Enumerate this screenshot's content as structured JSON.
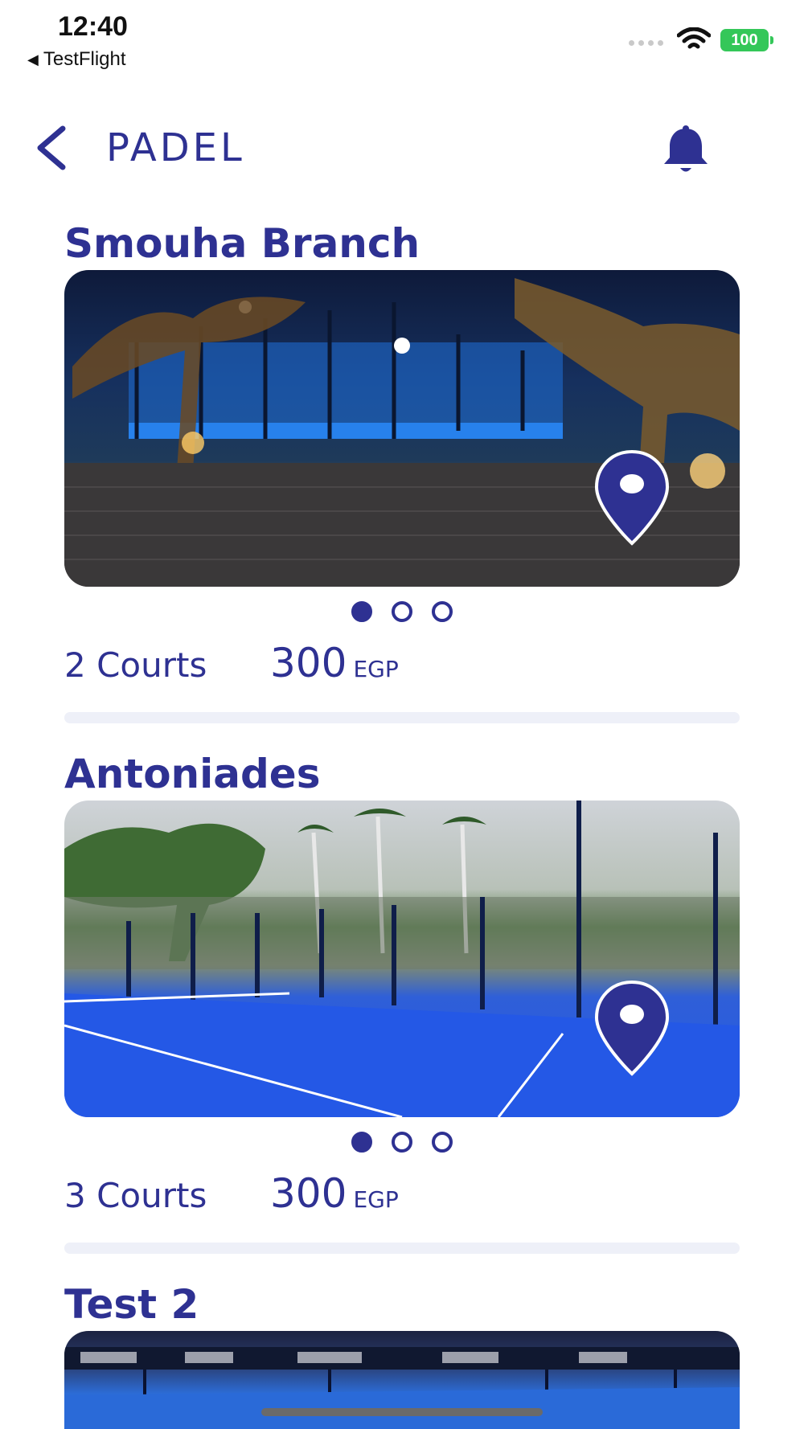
{
  "status_bar": {
    "time": "12:40",
    "back_app_label": "TestFlight",
    "battery": "100"
  },
  "header": {
    "title": "PADEL"
  },
  "branches": [
    {
      "name": "Smouha Branch",
      "courts": "2 Courts",
      "price": "300",
      "currency": "EGP",
      "photo_count": 3,
      "active_photo": 1
    },
    {
      "name": "Antoniades",
      "courts": "3 Courts",
      "price": "300",
      "currency": "EGP",
      "photo_count": 3,
      "active_photo": 1
    },
    {
      "name": "Test 2"
    }
  ],
  "colors": {
    "brand": "#2e3192",
    "divider": "#eef0f8",
    "battery": "#34c759"
  },
  "icons": {
    "back": "chevron-left-icon",
    "notifications": "bell-icon",
    "location": "map-pin-icon"
  }
}
